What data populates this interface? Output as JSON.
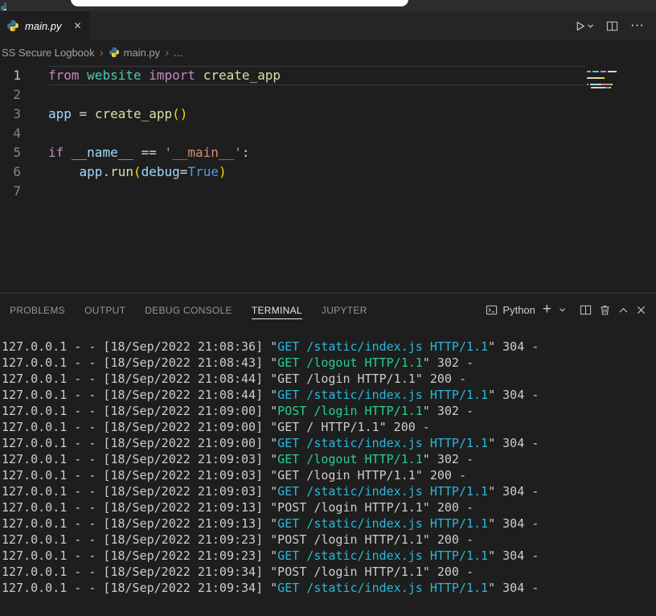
{
  "colors": {
    "tokens": {
      "kw": "#C586C0",
      "mod": "#4EC9B0",
      "fn": "#DCDCAA",
      "var": "#9CDCFE",
      "str": "#CE9178",
      "bool": "#569CD6",
      "pl": "#D4D4D4",
      "brk": "#FFD700"
    },
    "terminal": {
      "green": "#23d18b",
      "cyan": "#29b8db"
    },
    "python_blue": "#3B77A8",
    "python_yellow": "#F7D349"
  },
  "icons": {
    "close": "✕",
    "plus": "+",
    "more": "⋯"
  },
  "tabbar": {
    "tab": {
      "title": "main.py"
    }
  },
  "breadcrumb": {
    "separator": "›",
    "items": [
      {
        "label": "SS Secure Logbook",
        "icon": null
      },
      {
        "label": "main.py",
        "icon": "python"
      },
      {
        "label": "...",
        "icon": null
      }
    ]
  },
  "editor": {
    "active_line": 1,
    "lines": [
      {
        "num": 1,
        "tokens": [
          {
            "t": "from",
            "c": "kw"
          },
          {
            "t": " ",
            "c": "pl"
          },
          {
            "t": "website",
            "c": "mod"
          },
          {
            "t": " ",
            "c": "pl"
          },
          {
            "t": "import",
            "c": "kw"
          },
          {
            "t": " ",
            "c": "pl"
          },
          {
            "t": "create_app",
            "c": "fn"
          }
        ]
      },
      {
        "num": 2,
        "tokens": []
      },
      {
        "num": 3,
        "tokens": [
          {
            "t": "app",
            "c": "var"
          },
          {
            "t": " = ",
            "c": "pl"
          },
          {
            "t": "create_app",
            "c": "fn"
          },
          {
            "t": "(",
            "c": "brk"
          },
          {
            "t": ")",
            "c": "brk"
          }
        ]
      },
      {
        "num": 4,
        "tokens": []
      },
      {
        "num": 5,
        "tokens": [
          {
            "t": "if",
            "c": "kw"
          },
          {
            "t": " ",
            "c": "pl"
          },
          {
            "t": "__name__",
            "c": "var"
          },
          {
            "t": " == ",
            "c": "pl"
          },
          {
            "t": "'__main__'",
            "c": "str"
          },
          {
            "t": ":",
            "c": "pl"
          }
        ]
      },
      {
        "num": 6,
        "tokens": [
          {
            "t": "    ",
            "c": "pl"
          },
          {
            "t": "app",
            "c": "var"
          },
          {
            "t": ".",
            "c": "pl"
          },
          {
            "t": "run",
            "c": "fn"
          },
          {
            "t": "(",
            "c": "brk"
          },
          {
            "t": "debug",
            "c": "var"
          },
          {
            "t": "=",
            "c": "pl"
          },
          {
            "t": "True",
            "c": "bool"
          },
          {
            "t": ")",
            "c": "brk"
          }
        ]
      },
      {
        "num": 7,
        "tokens": []
      }
    ]
  },
  "panel": {
    "tabs": [
      {
        "label": "PROBLEMS",
        "active": false
      },
      {
        "label": "OUTPUT",
        "active": false
      },
      {
        "label": "DEBUG CONSOLE",
        "active": false
      },
      {
        "label": "TERMINAL",
        "active": true
      },
      {
        "label": "JUPYTER",
        "active": false
      }
    ],
    "profile_label": "Python"
  },
  "terminal": {
    "lines": [
      {
        "pre": "127.0.0.1 - - [18/Sep/2022 21:08:36] \"",
        "req": "GET /static/index.js HTTP/1.1",
        "post": "\" 304 -",
        "color": "cyan"
      },
      {
        "pre": "127.0.0.1 - - [18/Sep/2022 21:08:43] \"",
        "req": "GET /logout HTTP/1.1",
        "post": "\" 302 -",
        "color": "green"
      },
      {
        "pre": "127.0.0.1 - - [18/Sep/2022 21:08:44] \"",
        "req": "GET /login HTTP/1.1",
        "post": "\" 200 -",
        "color": "plain"
      },
      {
        "pre": "127.0.0.1 - - [18/Sep/2022 21:08:44] \"",
        "req": "GET /static/index.js HTTP/1.1",
        "post": "\" 304 -",
        "color": "cyan"
      },
      {
        "pre": "127.0.0.1 - - [18/Sep/2022 21:09:00] \"",
        "req": "POST /login HTTP/1.1",
        "post": "\" 302 -",
        "color": "green"
      },
      {
        "pre": "127.0.0.1 - - [18/Sep/2022 21:09:00] \"",
        "req": "GET / HTTP/1.1",
        "post": "\" 200 -",
        "color": "plain"
      },
      {
        "pre": "127.0.0.1 - - [18/Sep/2022 21:09:00] \"",
        "req": "GET /static/index.js HTTP/1.1",
        "post": "\" 304 -",
        "color": "cyan"
      },
      {
        "pre": "127.0.0.1 - - [18/Sep/2022 21:09:03] \"",
        "req": "GET /logout HTTP/1.1",
        "post": "\" 302 -",
        "color": "green"
      },
      {
        "pre": "127.0.0.1 - - [18/Sep/2022 21:09:03] \"",
        "req": "GET /login HTTP/1.1",
        "post": "\" 200 -",
        "color": "plain"
      },
      {
        "pre": "127.0.0.1 - - [18/Sep/2022 21:09:03] \"",
        "req": "GET /static/index.js HTTP/1.1",
        "post": "\" 304 -",
        "color": "cyan"
      },
      {
        "pre": "127.0.0.1 - - [18/Sep/2022 21:09:13] \"",
        "req": "POST /login HTTP/1.1",
        "post": "\" 200 -",
        "color": "plain"
      },
      {
        "pre": "127.0.0.1 - - [18/Sep/2022 21:09:13] \"",
        "req": "GET /static/index.js HTTP/1.1",
        "post": "\" 304 -",
        "color": "cyan"
      },
      {
        "pre": "127.0.0.1 - - [18/Sep/2022 21:09:23] \"",
        "req": "POST /login HTTP/1.1",
        "post": "\" 200 -",
        "color": "plain"
      },
      {
        "pre": "127.0.0.1 - - [18/Sep/2022 21:09:23] \"",
        "req": "GET /static/index.js HTTP/1.1",
        "post": "\" 304 -",
        "color": "cyan"
      },
      {
        "pre": "127.0.0.1 - - [18/Sep/2022 21:09:34] \"",
        "req": "POST /login HTTP/1.1",
        "post": "\" 200 -",
        "color": "plain"
      },
      {
        "pre": "127.0.0.1 - - [18/Sep/2022 21:09:34] \"",
        "req": "GET /static/index.js HTTP/1.1",
        "post": "\" 304 -",
        "color": "cyan"
      }
    ]
  }
}
